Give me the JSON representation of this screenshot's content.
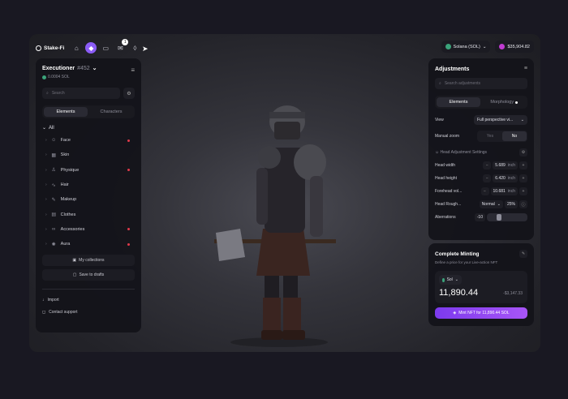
{
  "topbar": {
    "logo": "Stake-Fi",
    "notif_count": "1",
    "network": "Solana (SOL)",
    "balance": "$35,904.82"
  },
  "left": {
    "title": "Executioner",
    "number": "#452",
    "price": "0.0004 SOL",
    "search_placeholder": "Search",
    "tabs": [
      "Elements",
      "Characters"
    ],
    "all_label": "All",
    "categories": [
      {
        "label": "Face",
        "icon": "face-icon",
        "flag": true
      },
      {
        "label": "Skin",
        "icon": "skin-icon",
        "flag": false
      },
      {
        "label": "Physique",
        "icon": "physique-icon",
        "flag": true
      },
      {
        "label": "Hair",
        "icon": "hair-icon",
        "flag": false
      },
      {
        "label": "Makeup",
        "icon": "makeup-icon",
        "flag": false
      },
      {
        "label": "Clothes",
        "icon": "clothes-icon",
        "flag": false
      },
      {
        "label": "Accessories",
        "icon": "accessories-icon",
        "flag": true
      },
      {
        "label": "Aura",
        "icon": "aura-icon",
        "flag": true
      }
    ],
    "collections_btn": "My collections",
    "drafts_btn": "Save to drafts",
    "import": "Import",
    "support": "Contact support"
  },
  "adjust": {
    "title": "Adjustments",
    "search_placeholder": "Search adjustments",
    "tabs": [
      "Elements",
      "Morphology"
    ],
    "view_label": "View",
    "view_value": "Full perspective vi...",
    "zoom_label": "Manual zoom",
    "yes": "Yes",
    "no": "No",
    "head_settings": "Head Adjustment Settings",
    "params": [
      {
        "label": "Head width",
        "value": "5.689",
        "unit": "inch"
      },
      {
        "label": "Head height",
        "value": "6.420",
        "unit": "inch"
      },
      {
        "label": "Forehead vol...",
        "value": "10.681",
        "unit": "inch"
      }
    ],
    "rough_label": "Head Rough...",
    "rough_mode": "Normal",
    "rough_pct": "25%",
    "aberr_label": "Aberrations",
    "aberr_value": "-10"
  },
  "mint": {
    "title": "Complete Minting",
    "desc": "Define a price for your Live-action NFT",
    "currency": "Sol",
    "amount": "11,890.44",
    "usd": "-$3,147.33",
    "button": "Mint NFT for 11,890.44 SOL"
  }
}
